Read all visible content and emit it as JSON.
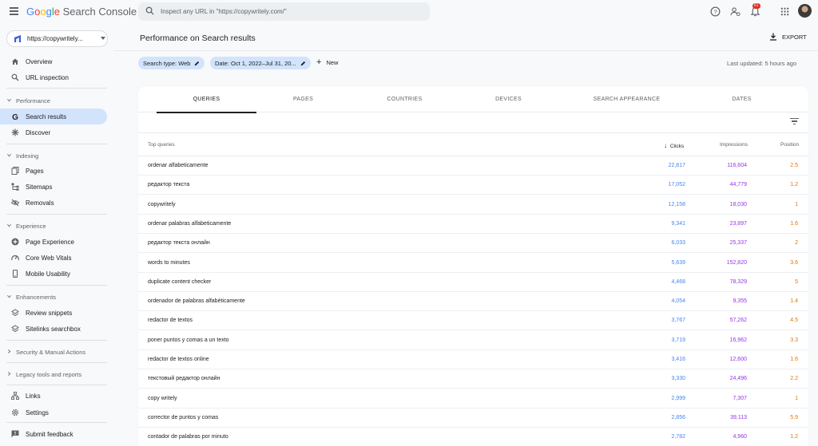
{
  "header": {
    "logo_letters": [
      "G",
      "o",
      "o",
      "g",
      "l",
      "e"
    ],
    "logo_rest": " Search Console",
    "search_placeholder": "Inspect any URL in \"https://copywritely.com/\"",
    "notification_count": "61"
  },
  "sidebar": {
    "property": "https://copywritely...",
    "top_items": [
      {
        "label": "Overview",
        "icon": "home-icon"
      },
      {
        "label": "URL inspection",
        "icon": "search-icon"
      }
    ],
    "sections": [
      {
        "label": "Performance",
        "items": [
          {
            "label": "Search results",
            "icon": "google-g-icon",
            "active": true
          },
          {
            "label": "Discover",
            "icon": "asterisk-icon"
          }
        ]
      },
      {
        "label": "Indexing",
        "items": [
          {
            "label": "Pages",
            "icon": "pages-icon"
          },
          {
            "label": "Sitemaps",
            "icon": "sitemap-icon"
          },
          {
            "label": "Removals",
            "icon": "removals-icon"
          }
        ]
      },
      {
        "label": "Experience",
        "items": [
          {
            "label": "Page Experience",
            "icon": "plus-circle-icon"
          },
          {
            "label": "Core Web Vitals",
            "icon": "speedometer-icon"
          },
          {
            "label": "Mobile Usability",
            "icon": "phone-icon"
          }
        ]
      },
      {
        "label": "Enhancements",
        "items": [
          {
            "label": "Review snippets",
            "icon": "layers-icon"
          },
          {
            "label": "Sitelinks searchbox",
            "icon": "layers-icon"
          }
        ]
      }
    ],
    "collapsed_sections": [
      "Security & Manual Actions",
      "Legacy tools and reports"
    ],
    "bottom_items": [
      {
        "label": "Links",
        "icon": "links-icon"
      },
      {
        "label": "Settings",
        "icon": "gear-icon"
      },
      {
        "label": "Submit feedback",
        "icon": "feedback-icon"
      }
    ]
  },
  "main": {
    "title": "Performance on Search results",
    "export_label": "EXPORT",
    "chips": {
      "search_type": "Search type: Web",
      "date": "Date: Oct 1, 2022–Jul 31, 20..."
    },
    "new_label": "New",
    "last_updated": "Last updated: 5 hours ago",
    "tabs": [
      "QUERIES",
      "PAGES",
      "COUNTRIES",
      "DEVICES",
      "SEARCH APPEARANCE",
      "DATES"
    ],
    "active_tab": "QUERIES",
    "columns": {
      "query": "Top queries",
      "clicks": "Clicks",
      "impressions": "Impressions",
      "position": "Position"
    },
    "rows": [
      {
        "query": "ordenar alfabeticamente",
        "clicks": "22,817",
        "impressions": "116,604",
        "position": "2.5"
      },
      {
        "query": "редактор текста",
        "clicks": "17,052",
        "impressions": "44,779",
        "position": "1.2"
      },
      {
        "query": "copywritely",
        "clicks": "12,158",
        "impressions": "18,030",
        "position": "1"
      },
      {
        "query": "ordenar palabras alfabeticamente",
        "clicks": "9,341",
        "impressions": "23,897",
        "position": "1.6"
      },
      {
        "query": "редактор текста онлайн",
        "clicks": "6,033",
        "impressions": "25,337",
        "position": "2"
      },
      {
        "query": "words to minutes",
        "clicks": "5,639",
        "impressions": "152,820",
        "position": "3.6"
      },
      {
        "query": "duplicate content checker",
        "clicks": "4,468",
        "impressions": "78,329",
        "position": "5"
      },
      {
        "query": "ordenador de palabras alfabéticamente",
        "clicks": "4,054",
        "impressions": "9,355",
        "position": "1.4"
      },
      {
        "query": "redactor de textos",
        "clicks": "3,767",
        "impressions": "57,262",
        "position": "4.5"
      },
      {
        "query": "poner puntos y comas a un texto",
        "clicks": "3,719",
        "impressions": "16,962",
        "position": "3.3"
      },
      {
        "query": "redactor de textos online",
        "clicks": "3,416",
        "impressions": "12,600",
        "position": "1.6"
      },
      {
        "query": "текстовый редактор онлайн",
        "clicks": "3,330",
        "impressions": "24,496",
        "position": "2.2"
      },
      {
        "query": "copy writely",
        "clicks": "2,999",
        "impressions": "7,307",
        "position": "1"
      },
      {
        "query": "corrector de puntos y comas",
        "clicks": "2,856",
        "impressions": "39,113",
        "position": "5.9"
      },
      {
        "query": "contador de palabras por minuto",
        "clicks": "2,782",
        "impressions": "4,960",
        "position": "1.2"
      }
    ]
  },
  "colors": {
    "clicks": "#4285f4",
    "impressions": "#9334e6",
    "position": "#e37400",
    "active_nav": "#d2e3fc"
  }
}
